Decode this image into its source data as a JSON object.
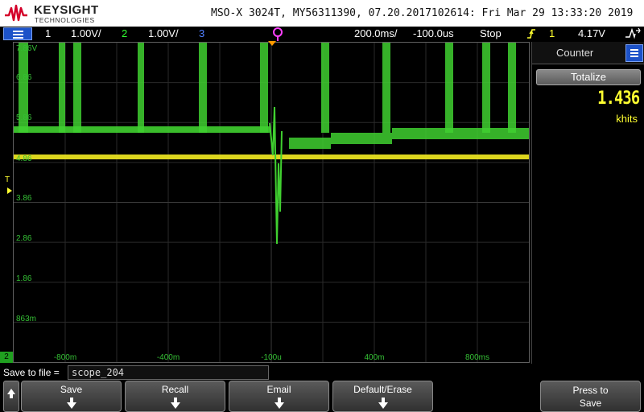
{
  "header": {
    "brand": "KEYSIGHT",
    "brand_sub": "TECHNOLOGIES",
    "device_info": "MSO-X 3024T, MY56311390, 07.20.2017102614: Fri Mar 29 13:33:20 2019"
  },
  "status_bar": {
    "ch1_num": "1",
    "ch1_scale": "1.00V/",
    "ch2_num": "2",
    "ch2_scale": "1.00V/",
    "ch3_num": "3",
    "timebase": "200.0ms/",
    "delay": "-100.0us",
    "run_state": "Stop",
    "trig_source": "1",
    "trig_level": "4.17V",
    "colors": {
      "ch1": "#ffff30",
      "ch2": "#30ff30",
      "ch3": "#5080ff",
      "trigger": "#ff9900"
    }
  },
  "graticule": {
    "volt_labels": [
      "7.86V",
      "6.86",
      "5.86",
      "4.86",
      "3.86",
      "2.86",
      "1.86",
      "863m"
    ],
    "time_labels": [
      "-800m",
      "-400m",
      "-100u",
      "400m",
      "800ms"
    ],
    "trigger_letter": "T",
    "ch2_badge": "2"
  },
  "side_panel": {
    "title": "Counter",
    "totalize_label": "Totalize",
    "count_value": "1.436",
    "count_unit": "khits"
  },
  "file_bar": {
    "label": "Save to file =",
    "filename": "scope_204"
  },
  "softkeys": {
    "save": "Save",
    "recall": "Recall",
    "email": "Email",
    "default_erase": "Default/Erase",
    "press_to": "Press to",
    "press_save": "Save"
  }
}
